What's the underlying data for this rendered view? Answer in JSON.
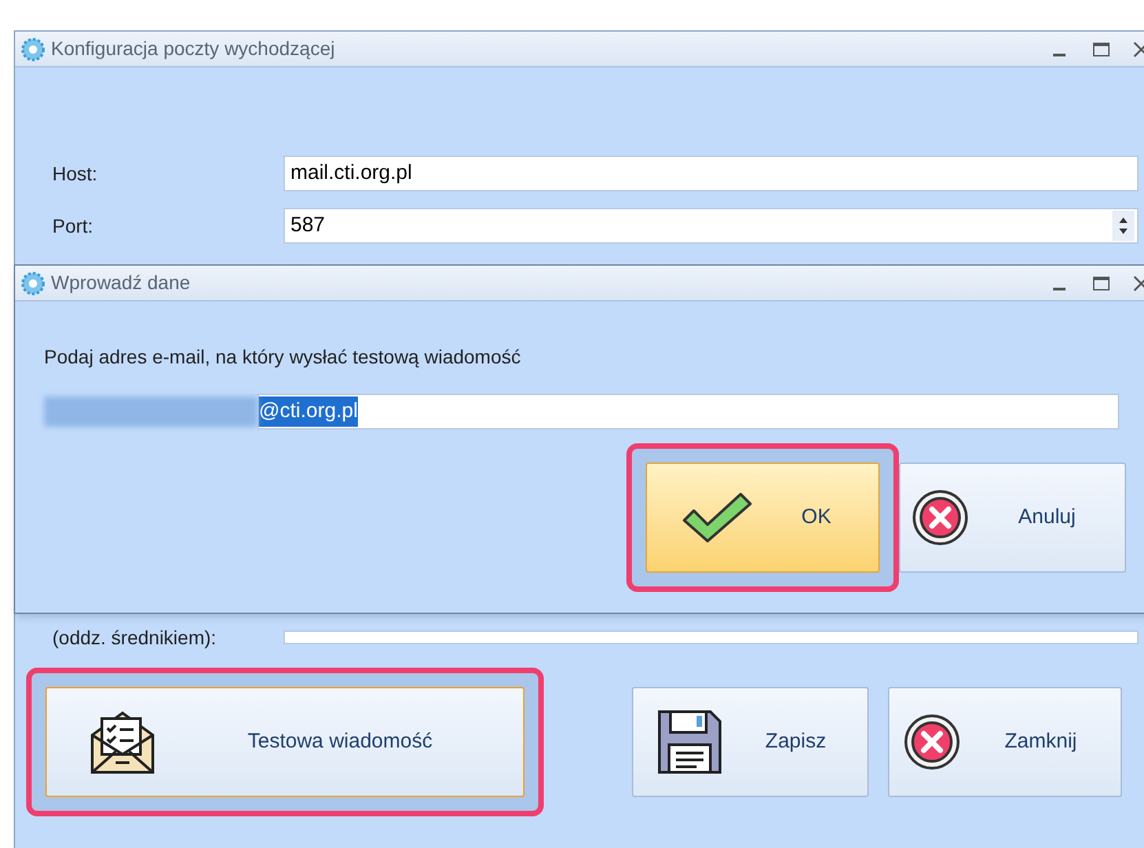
{
  "window": {
    "title": "Konfiguracja poczty wychodzącej"
  },
  "form": {
    "host": {
      "label": "Host:",
      "value": "mail.cti.org.pl"
    },
    "port": {
      "label": "Port:",
      "value": "587"
    },
    "recipients_label": "(oddz. średnikiem):"
  },
  "dialog": {
    "title": "Wprowadź dane",
    "prompt": "Podaj adres e-mail, na który wysłać testową wiadomość",
    "email": {
      "value": "@cti.org.pl",
      "selected": true
    },
    "buttons": [
      {
        "label": "OK",
        "kind": "ok",
        "hover": true,
        "highlighted": true
      },
      {
        "label": "Anuluj",
        "kind": "cancel",
        "hover": false,
        "highlighted": false
      }
    ]
  },
  "buttons": [
    {
      "label": "Testowa wiadomość",
      "kind": "test",
      "hover": false,
      "highlighted": true
    },
    {
      "label": "Zapisz",
      "kind": "save",
      "hover": false,
      "highlighted": false
    },
    {
      "label": "Zamknij",
      "kind": "cancel",
      "hover": false,
      "highlighted": false
    }
  ]
}
